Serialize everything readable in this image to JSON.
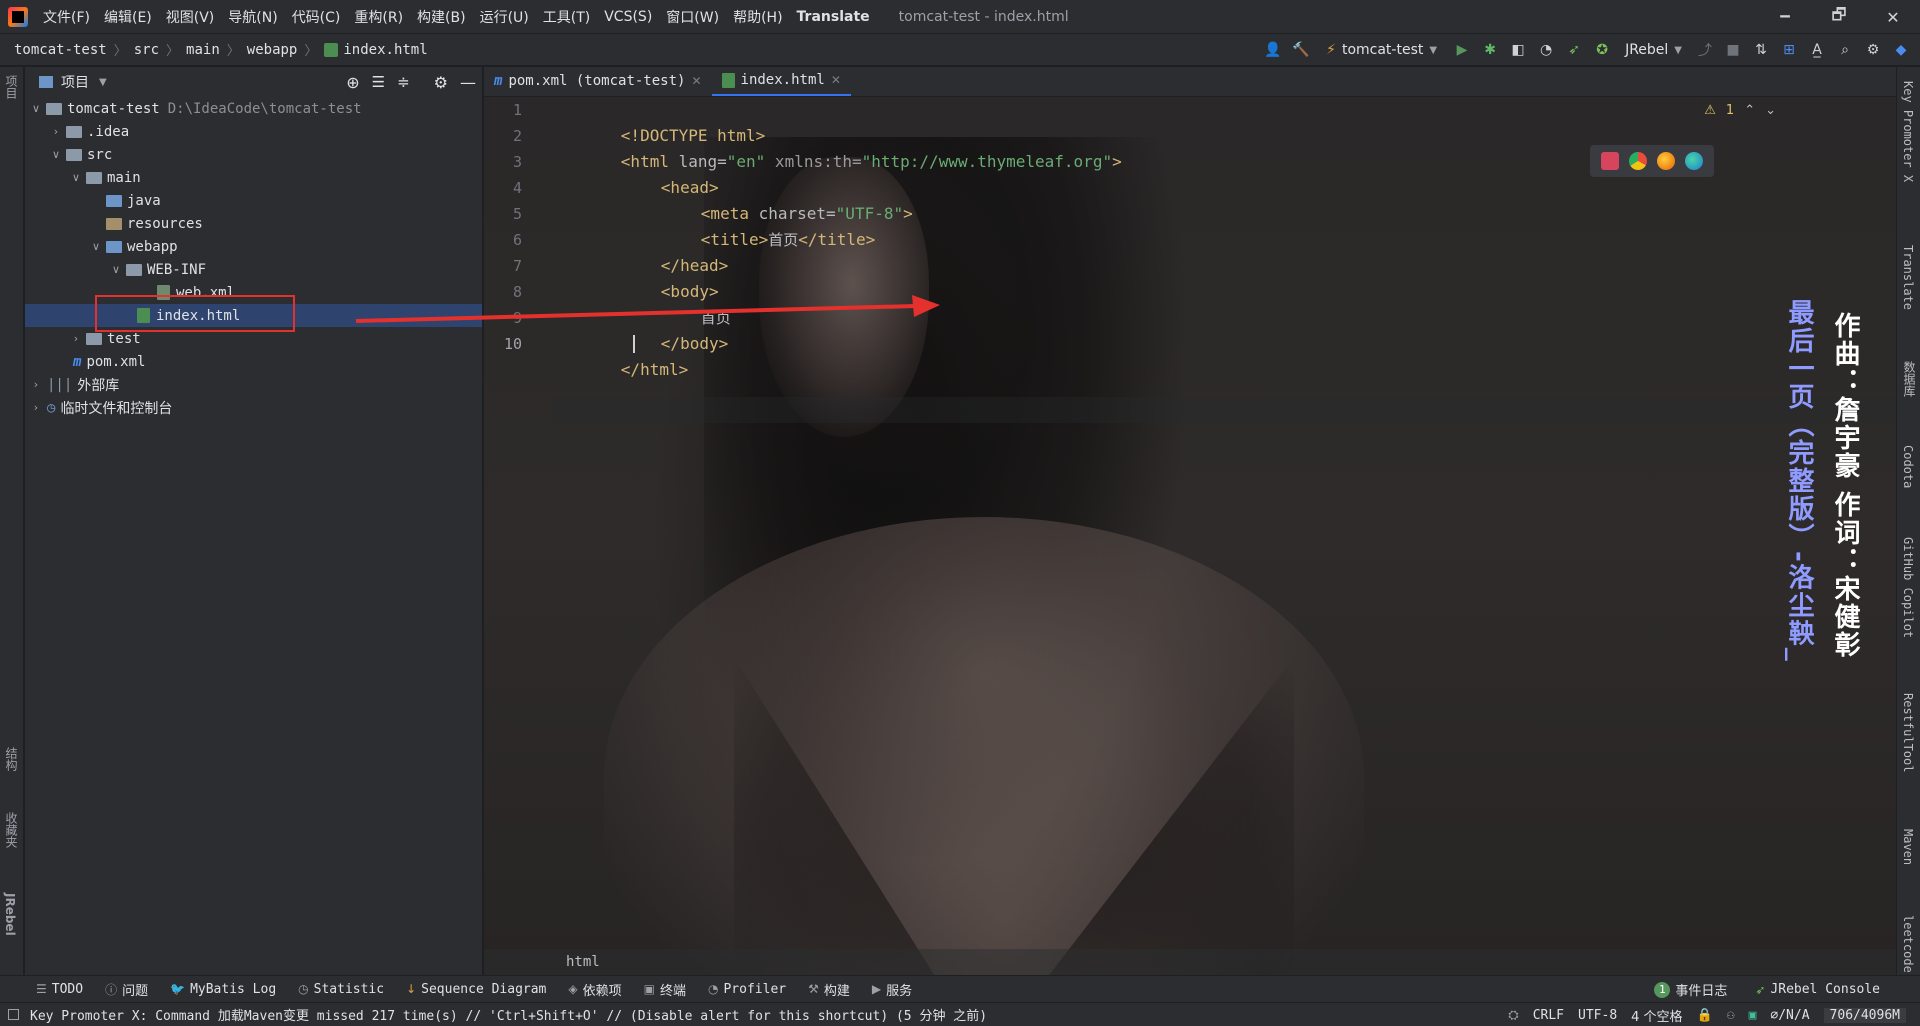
{
  "menubar": {
    "items": [
      "文件(F)",
      "编辑(E)",
      "视图(V)",
      "导航(N)",
      "代码(C)",
      "重构(R)",
      "构建(B)",
      "运行(U)",
      "工具(T)",
      "VCS(S)",
      "窗口(W)",
      "帮助(H)",
      "Translate"
    ],
    "window_title": "tomcat-test - index.html",
    "minimize": "🗕",
    "restore": "🗗",
    "close": "✕"
  },
  "breadcrumb": {
    "items": [
      "tomcat-test",
      "src",
      "main",
      "webapp",
      "index.html"
    ]
  },
  "toolbar": {
    "run_config": "tomcat-test",
    "jrebel": "JRebel"
  },
  "left_strip": {
    "project": "项目",
    "structure": "结构",
    "favorites": "收藏夹",
    "jrebel": "JRebel"
  },
  "project_panel": {
    "title": "项目",
    "tree": [
      {
        "label": "tomcat-test",
        "path": "D:\\IdeaCode\\tomcat-test"
      },
      {
        "label": ".idea"
      },
      {
        "label": "src"
      },
      {
        "label": "main"
      },
      {
        "label": "java"
      },
      {
        "label": "resources"
      },
      {
        "label": "webapp"
      },
      {
        "label": "WEB-INF"
      },
      {
        "label": "web.xml"
      },
      {
        "label": "index.html"
      },
      {
        "label": "test"
      },
      {
        "label": "pom.xml"
      },
      {
        "label": "外部库"
      },
      {
        "label": "临时文件和控制台"
      }
    ]
  },
  "editor": {
    "tabs": [
      {
        "label": "pom.xml (tomcat-test)"
      },
      {
        "label": "index.html"
      }
    ],
    "line_numbers": [
      "1",
      "2",
      "3",
      "4",
      "5",
      "6",
      "7",
      "8",
      "9",
      "10"
    ],
    "code": {
      "l1": "<!DOCTYPE html>",
      "l2_tag_open": "<html",
      "l2_attr1": " lang=",
      "l2_val1": "\"en\"",
      "l2_attr2": " xmlns:th=",
      "l2_val2": "\"http://www.thymeleaf.org\"",
      "l2_close": ">",
      "l3": "<head>",
      "l4_tag": "<meta",
      "l4_attr": " charset=",
      "l4_val": "\"UTF-8\"",
      "l4_close": ">",
      "l5_open": "<title>",
      "l5_text": "首页",
      "l5_close": "</title>",
      "l6": "</head>",
      "l7": "<body>",
      "l8": "首页",
      "l9": "</body>",
      "l10": "</html>"
    },
    "warning_count": "1",
    "breadcrumb": "html",
    "lyrics_right": "作曲：詹宇豪 作词：宋健彰",
    "lyrics_left": "最后一页（完整版）-洛尘鞅_"
  },
  "right_strip": {
    "items": [
      "Key Promoter X",
      "Translate",
      "数据库",
      "Codota",
      "GitHub Copilot",
      "RestfulTool",
      "Maven",
      "leetcode"
    ]
  },
  "bottombar": {
    "items": [
      "TODO",
      "问题",
      "MyBatis Log",
      "Statistic",
      "Sequence Diagram",
      "依赖项",
      "终端",
      "Profiler",
      "构建",
      "服务"
    ],
    "event_log": "事件日志",
    "event_count": "1",
    "jrebel_console": "JRebel Console"
  },
  "statusbar": {
    "message": "Key Promoter X: Command 加载Maven变更 missed 217 time(s) // 'Ctrl+Shift+O' // (Disable alert for this shortcut) (5 分钟 之前)",
    "line_sep": "CRLF",
    "encoding": "UTF-8",
    "indent": "4 个空格",
    "na": "∅/N/A",
    "memory": "706/4096M"
  },
  "colors": {
    "annotation_red": "#e5312d",
    "accent": "#3574f0",
    "lyrics_white": "#ffffff",
    "lyrics_purple": "#8f9bff"
  }
}
